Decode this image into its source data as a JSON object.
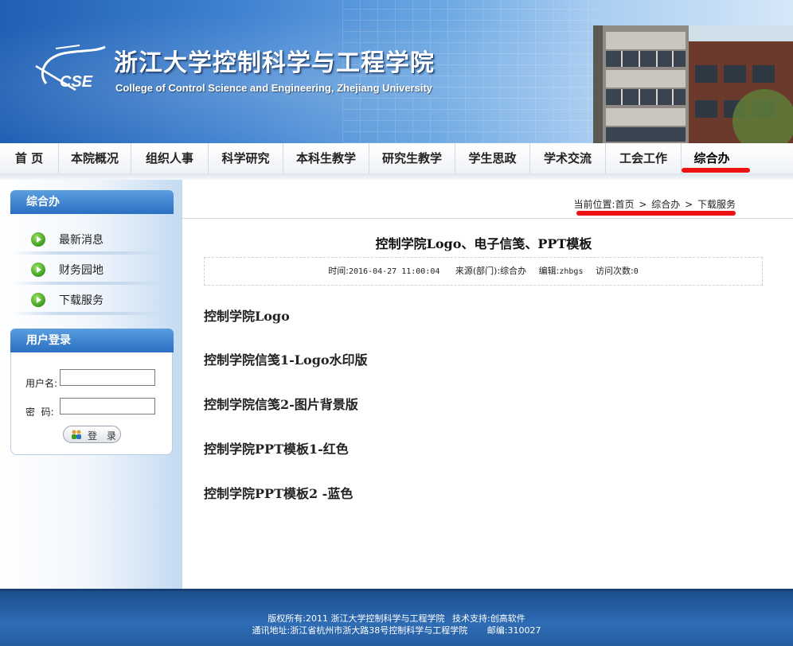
{
  "header": {
    "title_cn": "浙江大学控制科学与工程学院",
    "title_en": "College of Control Science and Engineering, Zhejiang University",
    "logo_text": "CSE"
  },
  "nav": {
    "items": [
      {
        "label": "首 页"
      },
      {
        "label": "本院概况"
      },
      {
        "label": "组织人事"
      },
      {
        "label": "科学研究"
      },
      {
        "label": "本科生教学"
      },
      {
        "label": "研究生教学"
      },
      {
        "label": "学生思政"
      },
      {
        "label": "学术交流"
      },
      {
        "label": "工会工作"
      },
      {
        "label": "综合办"
      }
    ],
    "active": "综合办"
  },
  "sidebar": {
    "section_title": "综合办",
    "links": [
      {
        "label": "最新消息"
      },
      {
        "label": "财务园地"
      },
      {
        "label": "下载服务"
      }
    ],
    "login": {
      "title": "用户登录",
      "username_label": "用户名:",
      "password_label": "密  码:",
      "username_value": "",
      "password_value": "",
      "button_label": "登 录"
    }
  },
  "breadcrumb": {
    "prefix": "当前位置:",
    "items": [
      "首页",
      "综合办",
      "下载服务"
    ],
    "separator": ">"
  },
  "article": {
    "title": "控制学院Logo、电子信笺、PPT模板",
    "meta": {
      "time_label": "时间:",
      "time_value": "2016-04-27 11:00:04",
      "source_label": "来源(部门):",
      "source_value": "综合办",
      "editor_label": "编辑:",
      "editor_value": "zhbgs",
      "visits_label": "访问次数:",
      "visits_value": "0"
    },
    "downloads": [
      {
        "label": "控制学院Logo"
      },
      {
        "label": "控制学院信笺1-Logo水印版"
      },
      {
        "label": "控制学院信笺2-图片背景版"
      },
      {
        "label": "控制学院PPT模板1-红色"
      },
      {
        "label": "控制学院PPT模板2 -蓝色"
      }
    ]
  },
  "footer": {
    "copyright_label": "版权所有:",
    "copyright_value": "2011 浙江大学控制科学与工程学院",
    "support_label": "技术支持:",
    "support_value": "创高软件",
    "address_label": "通讯地址:",
    "address_value": "浙江省杭州市浙大路38号控制科学与工程学院",
    "postcode_label": "邮编:",
    "postcode_value": "310027"
  },
  "colors": {
    "banner_blue": "#2a6fc2",
    "accent_red": "#ee1111",
    "footer_blue": "#1d4f8f",
    "bullet_green": "#3a9a1c"
  },
  "icons": [
    "cse-logo-icon",
    "play-bullet-icon",
    "login-users-icon",
    "building-photo"
  ]
}
